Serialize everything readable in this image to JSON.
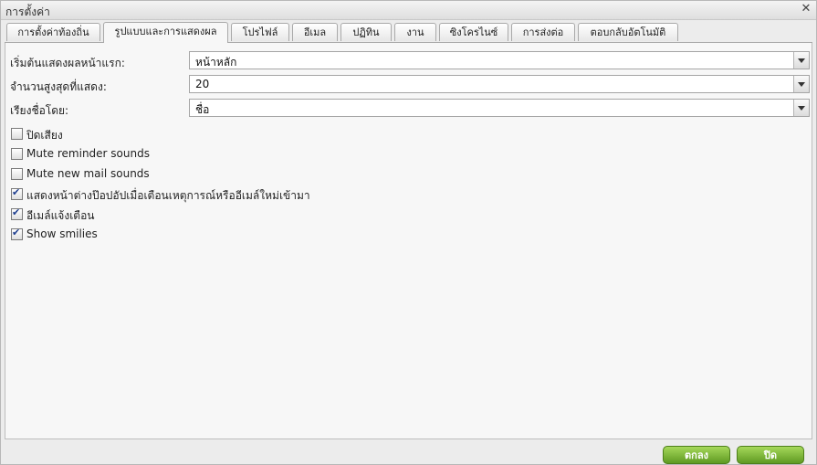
{
  "window": {
    "title": "การตั้งค่า"
  },
  "tabs": [
    {
      "label": "การตั้งค่าท้องถิ่น"
    },
    {
      "label": "รูปแบบและการแสดงผล"
    },
    {
      "label": "โปรไฟล์"
    },
    {
      "label": "อีเมล"
    },
    {
      "label": "ปฏิทิน"
    },
    {
      "label": "งาน"
    },
    {
      "label": "ซิงโครไนซ์"
    },
    {
      "label": "การส่งต่อ"
    },
    {
      "label": "ตอบกลับอัตโนมัติ"
    }
  ],
  "active_tab": "รูปแบบและการแสดงผล",
  "fields": [
    {
      "label": "เริ่มต้นแสดงผลหน้าแรก:",
      "value": "หน้าหลัก"
    },
    {
      "label": "จำนวนสูงสุดที่แสดง:",
      "value": "20"
    },
    {
      "label": "เรียงชื่อโดย:",
      "value": "ชื่อ"
    }
  ],
  "options": [
    {
      "label": "ปิดเสียง",
      "checked": false
    },
    {
      "label": "Mute reminder sounds",
      "checked": false
    },
    {
      "label": "Mute new mail sounds",
      "checked": false
    },
    {
      "label": "แสดงหน้าต่างป๊อปอัปเมื่อเตือนเหตุการณ์หรืออีเมล์ใหม่เข้ามา",
      "checked": true
    },
    {
      "label": "อีเมล์แจ้งเตือน",
      "checked": true
    },
    {
      "label": "Show smilies",
      "checked": true
    }
  ],
  "footer": {
    "ok_label": "ตกลง",
    "close_label": "ปิด"
  },
  "colors": {
    "button_green": "#6aa52b",
    "check_blue": "#1f3f8f"
  }
}
